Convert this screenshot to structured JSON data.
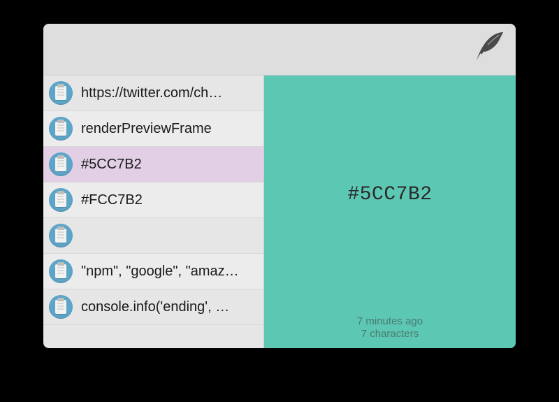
{
  "search": {
    "placeholder": "",
    "value": ""
  },
  "items": [
    {
      "label": "https://twitter.com/ch…",
      "selected": false
    },
    {
      "label": "renderPreviewFrame",
      "selected": false
    },
    {
      "label": "#5CC7B2",
      "selected": true
    },
    {
      "label": "#FCC7B2",
      "selected": false
    },
    {
      "label": "",
      "selected": false
    },
    {
      "label": "\"npm\", \"google\", \"amaz…",
      "selected": false
    },
    {
      "label": "console.info('ending', …",
      "selected": false
    }
  ],
  "preview": {
    "content": "#5CC7B2",
    "background": "#5CC7B2",
    "meta_time": "7 minutes ago",
    "meta_chars": "7 characters"
  }
}
